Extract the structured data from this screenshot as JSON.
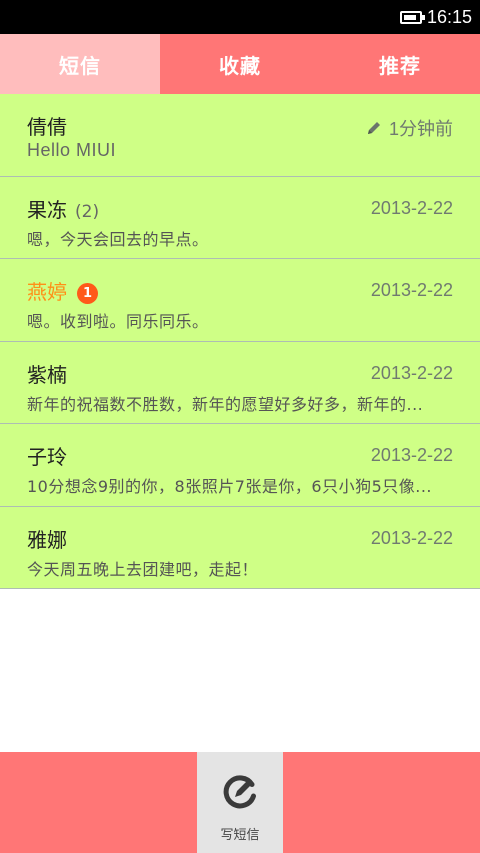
{
  "status_bar": {
    "time": "16:15",
    "battery_icon": "battery-icon"
  },
  "tabs": [
    {
      "label": "短信",
      "active": true
    },
    {
      "label": "收藏",
      "active": false
    },
    {
      "label": "推荐",
      "active": false
    }
  ],
  "messages": [
    {
      "name": "倩倩",
      "count": "",
      "badge": "",
      "time": "1分钟前",
      "draft_icon": "pencil-icon",
      "preview": "Hello MIUI"
    },
    {
      "name": "果冻",
      "count": "(2)",
      "badge": "",
      "time": "2013-2-22",
      "preview": "嗯，今天会回去的早点。"
    },
    {
      "name": "燕婷",
      "count": "",
      "badge": "1",
      "time": "2013-2-22",
      "preview": "嗯。收到啦。同乐同乐。"
    },
    {
      "name": "紫楠",
      "count": "",
      "badge": "",
      "time": "2013-2-22",
      "preview": "新年的祝福数不胜数，新年的愿望好多好多，新年的..."
    },
    {
      "name": "子玲",
      "count": "",
      "badge": "",
      "time": "2013-2-22",
      "preview": "10分想念9别的你，8张照片7张是你，6只小狗5只像..."
    },
    {
      "name": "雅娜",
      "count": "",
      "badge": "",
      "time": "2013-2-22",
      "preview": "今天周五晚上去团建吧，走起！"
    }
  ],
  "bottom_bar": {
    "compose_label": "写短信",
    "compose_icon": "compose-icon"
  },
  "colors": {
    "tab_bar": "#ff7676",
    "tab_active": "#ffbdbd",
    "row_background": "#cfff86",
    "unread_name": "#ff8f17",
    "badge": "#ff5a1a"
  }
}
